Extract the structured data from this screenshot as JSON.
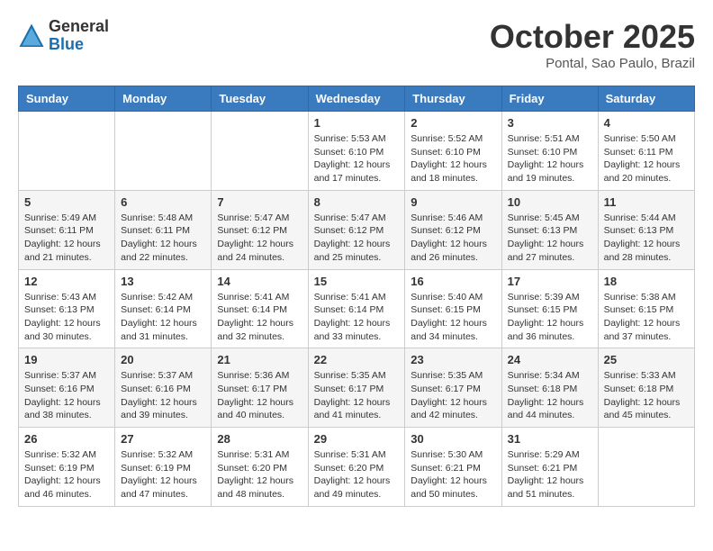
{
  "logo": {
    "general": "General",
    "blue": "Blue"
  },
  "title": "October 2025",
  "location": "Pontal, Sao Paulo, Brazil",
  "days_header": [
    "Sunday",
    "Monday",
    "Tuesday",
    "Wednesday",
    "Thursday",
    "Friday",
    "Saturday"
  ],
  "weeks": [
    [
      {
        "day": "",
        "info": ""
      },
      {
        "day": "",
        "info": ""
      },
      {
        "day": "",
        "info": ""
      },
      {
        "day": "1",
        "info": "Sunrise: 5:53 AM\nSunset: 6:10 PM\nDaylight: 12 hours\nand 17 minutes."
      },
      {
        "day": "2",
        "info": "Sunrise: 5:52 AM\nSunset: 6:10 PM\nDaylight: 12 hours\nand 18 minutes."
      },
      {
        "day": "3",
        "info": "Sunrise: 5:51 AM\nSunset: 6:10 PM\nDaylight: 12 hours\nand 19 minutes."
      },
      {
        "day": "4",
        "info": "Sunrise: 5:50 AM\nSunset: 6:11 PM\nDaylight: 12 hours\nand 20 minutes."
      }
    ],
    [
      {
        "day": "5",
        "info": "Sunrise: 5:49 AM\nSunset: 6:11 PM\nDaylight: 12 hours\nand 21 minutes."
      },
      {
        "day": "6",
        "info": "Sunrise: 5:48 AM\nSunset: 6:11 PM\nDaylight: 12 hours\nand 22 minutes."
      },
      {
        "day": "7",
        "info": "Sunrise: 5:47 AM\nSunset: 6:12 PM\nDaylight: 12 hours\nand 24 minutes."
      },
      {
        "day": "8",
        "info": "Sunrise: 5:47 AM\nSunset: 6:12 PM\nDaylight: 12 hours\nand 25 minutes."
      },
      {
        "day": "9",
        "info": "Sunrise: 5:46 AM\nSunset: 6:12 PM\nDaylight: 12 hours\nand 26 minutes."
      },
      {
        "day": "10",
        "info": "Sunrise: 5:45 AM\nSunset: 6:13 PM\nDaylight: 12 hours\nand 27 minutes."
      },
      {
        "day": "11",
        "info": "Sunrise: 5:44 AM\nSunset: 6:13 PM\nDaylight: 12 hours\nand 28 minutes."
      }
    ],
    [
      {
        "day": "12",
        "info": "Sunrise: 5:43 AM\nSunset: 6:13 PM\nDaylight: 12 hours\nand 30 minutes."
      },
      {
        "day": "13",
        "info": "Sunrise: 5:42 AM\nSunset: 6:14 PM\nDaylight: 12 hours\nand 31 minutes."
      },
      {
        "day": "14",
        "info": "Sunrise: 5:41 AM\nSunset: 6:14 PM\nDaylight: 12 hours\nand 32 minutes."
      },
      {
        "day": "15",
        "info": "Sunrise: 5:41 AM\nSunset: 6:14 PM\nDaylight: 12 hours\nand 33 minutes."
      },
      {
        "day": "16",
        "info": "Sunrise: 5:40 AM\nSunset: 6:15 PM\nDaylight: 12 hours\nand 34 minutes."
      },
      {
        "day": "17",
        "info": "Sunrise: 5:39 AM\nSunset: 6:15 PM\nDaylight: 12 hours\nand 36 minutes."
      },
      {
        "day": "18",
        "info": "Sunrise: 5:38 AM\nSunset: 6:15 PM\nDaylight: 12 hours\nand 37 minutes."
      }
    ],
    [
      {
        "day": "19",
        "info": "Sunrise: 5:37 AM\nSunset: 6:16 PM\nDaylight: 12 hours\nand 38 minutes."
      },
      {
        "day": "20",
        "info": "Sunrise: 5:37 AM\nSunset: 6:16 PM\nDaylight: 12 hours\nand 39 minutes."
      },
      {
        "day": "21",
        "info": "Sunrise: 5:36 AM\nSunset: 6:17 PM\nDaylight: 12 hours\nand 40 minutes."
      },
      {
        "day": "22",
        "info": "Sunrise: 5:35 AM\nSunset: 6:17 PM\nDaylight: 12 hours\nand 41 minutes."
      },
      {
        "day": "23",
        "info": "Sunrise: 5:35 AM\nSunset: 6:17 PM\nDaylight: 12 hours\nand 42 minutes."
      },
      {
        "day": "24",
        "info": "Sunrise: 5:34 AM\nSunset: 6:18 PM\nDaylight: 12 hours\nand 44 minutes."
      },
      {
        "day": "25",
        "info": "Sunrise: 5:33 AM\nSunset: 6:18 PM\nDaylight: 12 hours\nand 45 minutes."
      }
    ],
    [
      {
        "day": "26",
        "info": "Sunrise: 5:32 AM\nSunset: 6:19 PM\nDaylight: 12 hours\nand 46 minutes."
      },
      {
        "day": "27",
        "info": "Sunrise: 5:32 AM\nSunset: 6:19 PM\nDaylight: 12 hours\nand 47 minutes."
      },
      {
        "day": "28",
        "info": "Sunrise: 5:31 AM\nSunset: 6:20 PM\nDaylight: 12 hours\nand 48 minutes."
      },
      {
        "day": "29",
        "info": "Sunrise: 5:31 AM\nSunset: 6:20 PM\nDaylight: 12 hours\nand 49 minutes."
      },
      {
        "day": "30",
        "info": "Sunrise: 5:30 AM\nSunset: 6:21 PM\nDaylight: 12 hours\nand 50 minutes."
      },
      {
        "day": "31",
        "info": "Sunrise: 5:29 AM\nSunset: 6:21 PM\nDaylight: 12 hours\nand 51 minutes."
      },
      {
        "day": "",
        "info": ""
      }
    ]
  ]
}
